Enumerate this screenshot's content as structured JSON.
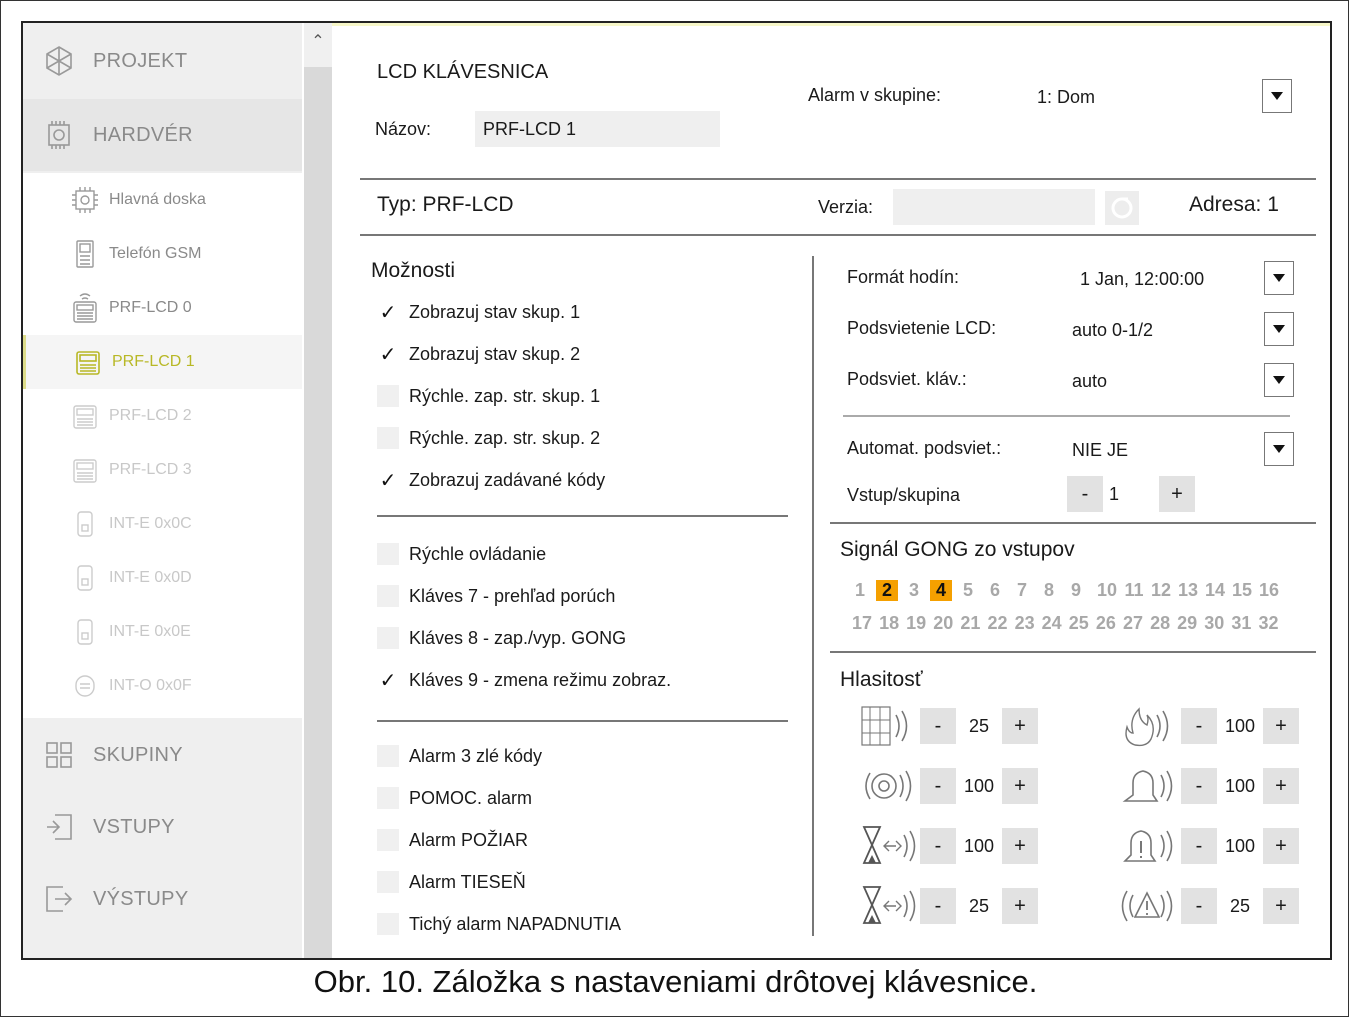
{
  "sidebar": {
    "sections": [
      {
        "label": "PROJEKT",
        "icon": "project-icon"
      },
      {
        "label": "HARDVÉR",
        "icon": "hardware-icon"
      }
    ],
    "hardware_items": [
      {
        "label": "Hlavná doska",
        "icon": "mainboard-icon"
      },
      {
        "label": "Telefón GSM",
        "icon": "gsm-phone-icon"
      },
      {
        "label": "PRF-LCD 0",
        "icon": "wireless-keypad-icon"
      },
      {
        "label": "PRF-LCD 1",
        "icon": "keypad-icon",
        "active": true
      },
      {
        "label": "PRF-LCD 2",
        "icon": "keypad-icon"
      },
      {
        "label": "PRF-LCD 3",
        "icon": "keypad-icon"
      },
      {
        "label": "INT-E 0x0C",
        "icon": "expander-icon"
      },
      {
        "label": "INT-E 0x0D",
        "icon": "expander-icon"
      },
      {
        "label": "INT-E 0x0E",
        "icon": "expander-icon"
      },
      {
        "label": "INT-O 0x0F",
        "icon": "output-expander-icon"
      }
    ],
    "bottom_sections": [
      {
        "label": "SKUPINY",
        "icon": "groups-icon"
      },
      {
        "label": "VSTUPY",
        "icon": "inputs-icon"
      },
      {
        "label": "VÝSTUPY",
        "icon": "outputs-icon"
      }
    ]
  },
  "header": {
    "title": "LCD KLÁVESNICA",
    "name_label": "Názov:",
    "name_value": "PRF-LCD 1",
    "alarm_group_label": "Alarm v skupine:",
    "alarm_group_value": "1: Dom"
  },
  "info": {
    "type_label": "Typ:",
    "type_value": "PRF-LCD",
    "version_label": "Verzia:",
    "version_value": "",
    "address_label": "Adresa:",
    "address_value": "1"
  },
  "options": {
    "title": "Možnosti",
    "group1": [
      {
        "label": "Zobrazuj stav skup. 1",
        "checked": true
      },
      {
        "label": "Zobrazuj stav skup. 2",
        "checked": true
      },
      {
        "label": "Rýchle. zap. str. skup. 1",
        "checked": false
      },
      {
        "label": "Rýchle. zap. str. skup. 2",
        "checked": false
      },
      {
        "label": "Zobrazuj zadávané kódy",
        "checked": true
      }
    ],
    "group2": [
      {
        "label": "Rýchle ovládanie",
        "checked": false
      },
      {
        "label": "Kláves 7 - prehľad porúch",
        "checked": false
      },
      {
        "label": "Kláves 8 - zap./vyp. GONG",
        "checked": false
      },
      {
        "label": "Kláves 9 - zmena režimu zobraz.",
        "checked": true
      }
    ],
    "group3": [
      {
        "label": "Alarm 3 zlé kódy",
        "checked": false
      },
      {
        "label": "POMOC. alarm",
        "checked": false
      },
      {
        "label": "Alarm POŽIAR",
        "checked": false
      },
      {
        "label": "Alarm TIESEŇ",
        "checked": false
      },
      {
        "label": "Tichý alarm NAPADNUTIA",
        "checked": false
      }
    ]
  },
  "settings": {
    "clock_format_label": "Formát hodín:",
    "clock_format_value": "1 Jan, 12:00:00",
    "lcd_backlight_label": "Podsvietenie LCD:",
    "lcd_backlight_value": "auto 0-1/2",
    "key_backlight_label": "Podsviet. kláv.:",
    "key_backlight_value": "auto",
    "auto_backlight_label": "Automat. podsviet.:",
    "auto_backlight_value": "NIE JE",
    "input_group_label": "Vstup/skupina",
    "input_group_value": "1"
  },
  "gong": {
    "title": "Signál GONG zo vstupov",
    "numbers": [
      "1",
      "2",
      "3",
      "4",
      "5",
      "6",
      "7",
      "8",
      "9",
      "10",
      "11",
      "12",
      "13",
      "14",
      "15",
      "16",
      "17",
      "18",
      "19",
      "20",
      "21",
      "22",
      "23",
      "24",
      "25",
      "26",
      "27",
      "28",
      "29",
      "30",
      "31",
      "32"
    ],
    "selected": [
      "2",
      "4"
    ]
  },
  "volume": {
    "title": "Hlasitosť",
    "items": [
      {
        "icon": "keypad-sound-icon",
        "value": "25"
      },
      {
        "icon": "fire-sound-icon",
        "value": "100"
      },
      {
        "icon": "siren-sound-icon",
        "value": "100"
      },
      {
        "icon": "bell-sound-icon",
        "value": "100"
      },
      {
        "icon": "entry-delay-sound-icon",
        "value": "100"
      },
      {
        "icon": "bell-warning-sound-icon",
        "value": "100"
      },
      {
        "icon": "exit-delay-sound-icon",
        "value": "25"
      },
      {
        "icon": "warning-sound-icon",
        "value": "25"
      }
    ],
    "minus": "-",
    "plus": "+"
  },
  "caption": "Obr. 10. Záložka s nastaveniami drôtovej klávesnice."
}
